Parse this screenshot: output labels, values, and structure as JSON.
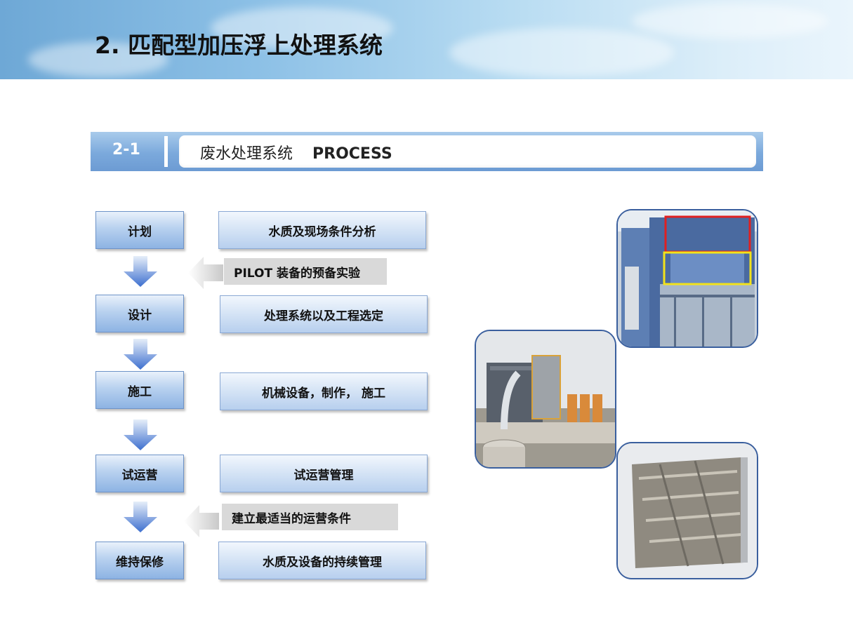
{
  "page_title": "2. 匹配型加压浮上处理系统",
  "section": {
    "number": "2-1",
    "label_cn": "废水处理系统",
    "label_en": "PROCESS"
  },
  "flow": [
    {
      "stage": "计划",
      "description": "水质及现场条件分析"
    },
    {
      "stage": "设计",
      "description": "处理系统以及工程选定"
    },
    {
      "stage": "施工",
      "description": "机械设备，制作，  施工"
    },
    {
      "stage": "试运营",
      "description": "试运营管理"
    },
    {
      "stage": "维持保修",
      "description": "水质及设备的持续管理"
    }
  ],
  "notes": [
    {
      "text": "PILOT 装备的预备实验"
    },
    {
      "text": "建立最适当的运营条件"
    }
  ],
  "colors": {
    "arrow_blue": "#4a78d0",
    "photo_border": "#3a5f9e",
    "highlight_red": "#e02020",
    "highlight_yellow": "#f2e21a"
  }
}
